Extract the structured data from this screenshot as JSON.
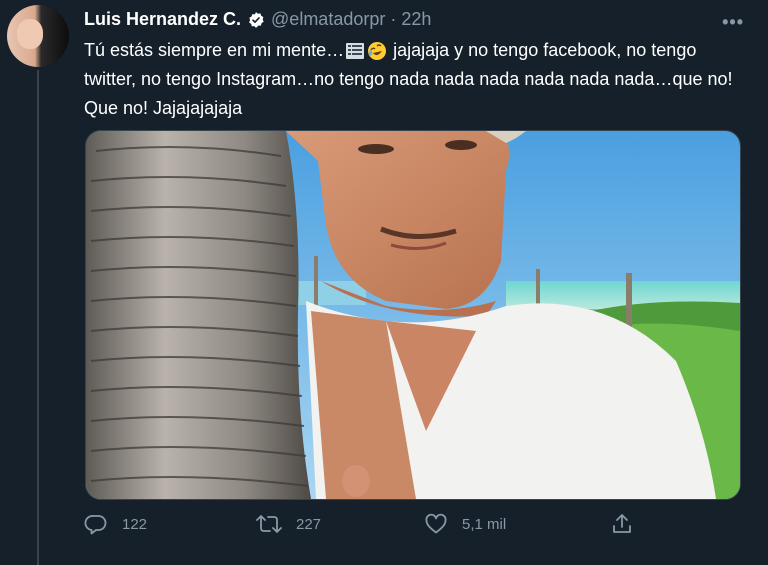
{
  "author": {
    "name": "Luis Hernandez C.",
    "handle": "@elmatadorpr",
    "time": "22h",
    "verified": true
  },
  "tweet": {
    "text_part1": "Tú estás siempre en mi mente…",
    "text_part2": " jajajaja y no tengo facebook, no tengo twitter, no tengo Instagram…no tengo nada nada nada nada nada nada…que no! Que no! Jajajajajaja",
    "emojis": [
      "memo-icon",
      "rolling-laughing-face-icon"
    ]
  },
  "actions": {
    "replies": "122",
    "retweets": "227",
    "likes": "5,1 mil"
  },
  "colors": {
    "background": "#15202b",
    "text": "#ffffff",
    "muted": "#8899a6",
    "verified": "#ffffff"
  }
}
